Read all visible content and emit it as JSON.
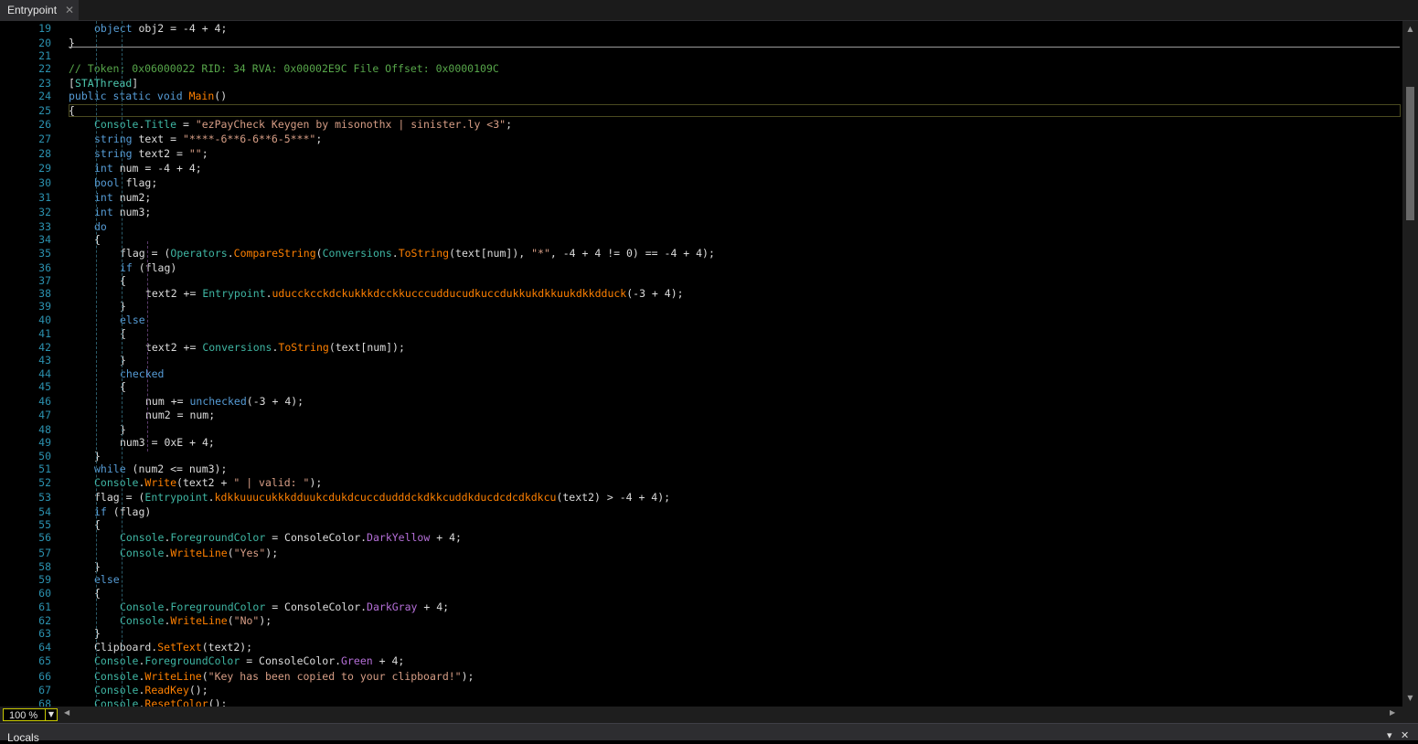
{
  "tab": {
    "label": "Entrypoint",
    "close": "✕"
  },
  "zoom": {
    "value": "100 %"
  },
  "bottom_panel": {
    "title": "Locals"
  },
  "lines": [
    {
      "n": "19",
      "ind": 2,
      "t": [
        [
          "kw",
          "object"
        ],
        [
          "pl",
          " obj2 = -4 + 4;"
        ]
      ]
    },
    {
      "n": "20",
      "ind": 1,
      "t": [
        [
          "pl",
          "}"
        ]
      ]
    },
    {
      "n": "21",
      "ind": 0,
      "t": []
    },
    {
      "n": "22",
      "ind": 1,
      "t": [
        [
          "cm",
          "// Token: 0x06000022 RID: 34 RVA: 0x00002E9C File Offset: 0x0000109C"
        ]
      ]
    },
    {
      "n": "23",
      "ind": 1,
      "t": [
        [
          "pl",
          "["
        ],
        [
          "cl",
          "STAThread"
        ],
        [
          "pl",
          "]"
        ]
      ]
    },
    {
      "n": "24",
      "ind": 1,
      "t": [
        [
          "kw",
          "public static void "
        ],
        [
          "me",
          "Main"
        ],
        [
          "pl",
          "()"
        ]
      ]
    },
    {
      "n": "25",
      "ind": 1,
      "t": [
        [
          "pl",
          "{"
        ]
      ]
    },
    {
      "n": "26",
      "ind": 2,
      "t": [
        [
          "pr",
          "Console"
        ],
        [
          "pl",
          "."
        ],
        [
          "pr",
          "Title"
        ],
        [
          "pl",
          " = "
        ],
        [
          "st",
          "\"ezPayCheck Keygen by misonothx | sinister.ly <3\""
        ],
        [
          "pl",
          ";"
        ]
      ]
    },
    {
      "n": "27",
      "ind": 2,
      "t": [
        [
          "kw",
          "string"
        ],
        [
          "pl",
          " text = "
        ],
        [
          "st",
          "\"****-6**6-6**6-5***\""
        ],
        [
          "pl",
          ";"
        ]
      ]
    },
    {
      "n": "28",
      "ind": 2,
      "t": [
        [
          "kw",
          "string"
        ],
        [
          "pl",
          " text2 = "
        ],
        [
          "st",
          "\"\""
        ],
        [
          "pl",
          ";"
        ]
      ]
    },
    {
      "n": "29",
      "ind": 2,
      "t": [
        [
          "kw",
          "int"
        ],
        [
          "pl",
          " num = -4 + 4;"
        ]
      ]
    },
    {
      "n": "30",
      "ind": 2,
      "t": [
        [
          "kw",
          "bool"
        ],
        [
          "pl",
          " flag;"
        ]
      ]
    },
    {
      "n": "31",
      "ind": 2,
      "t": [
        [
          "kw",
          "int"
        ],
        [
          "pl",
          " num2;"
        ]
      ]
    },
    {
      "n": "32",
      "ind": 2,
      "t": [
        [
          "kw",
          "int"
        ],
        [
          "pl",
          " num3;"
        ]
      ]
    },
    {
      "n": "33",
      "ind": 2,
      "t": [
        [
          "kw",
          "do"
        ]
      ]
    },
    {
      "n": "34",
      "ind": 2,
      "t": [
        [
          "pl",
          "{"
        ]
      ]
    },
    {
      "n": "35",
      "ind": 3,
      "t": [
        [
          "pl",
          "flag = ("
        ],
        [
          "pr",
          "Operators"
        ],
        [
          "pl",
          "."
        ],
        [
          "me",
          "CompareString"
        ],
        [
          "pl",
          "("
        ],
        [
          "pr",
          "Conversions"
        ],
        [
          "pl",
          "."
        ],
        [
          "me",
          "ToString"
        ],
        [
          "pl",
          "(text[num]), "
        ],
        [
          "st",
          "\"*\""
        ],
        [
          "pl",
          ", -4 + 4 != 0) == -4 + 4);"
        ]
      ]
    },
    {
      "n": "36",
      "ind": 3,
      "t": [
        [
          "kw",
          "if"
        ],
        [
          "pl",
          " (flag)"
        ]
      ]
    },
    {
      "n": "37",
      "ind": 3,
      "t": [
        [
          "pl",
          "{"
        ]
      ]
    },
    {
      "n": "38",
      "ind": 4,
      "t": [
        [
          "pl",
          "text2 += "
        ],
        [
          "pr",
          "Entrypoint"
        ],
        [
          "pl",
          "."
        ],
        [
          "me",
          "uducckcckdckukkkdcckkucccudducudkuccdukkukdkkuukdkkdduck"
        ],
        [
          "pl",
          "(-3 + 4);"
        ]
      ]
    },
    {
      "n": "39",
      "ind": 3,
      "t": [
        [
          "pl",
          "}"
        ]
      ]
    },
    {
      "n": "40",
      "ind": 3,
      "t": [
        [
          "kw",
          "else"
        ]
      ]
    },
    {
      "n": "41",
      "ind": 3,
      "t": [
        [
          "pl",
          "{"
        ]
      ]
    },
    {
      "n": "42",
      "ind": 4,
      "t": [
        [
          "pl",
          "text2 += "
        ],
        [
          "pr",
          "Conversions"
        ],
        [
          "pl",
          "."
        ],
        [
          "me",
          "ToString"
        ],
        [
          "pl",
          "(text[num]);"
        ]
      ]
    },
    {
      "n": "43",
      "ind": 3,
      "t": [
        [
          "pl",
          "}"
        ]
      ]
    },
    {
      "n": "44",
      "ind": 3,
      "t": [
        [
          "kw",
          "checked"
        ]
      ]
    },
    {
      "n": "45",
      "ind": 3,
      "t": [
        [
          "pl",
          "{"
        ]
      ]
    },
    {
      "n": "46",
      "ind": 4,
      "t": [
        [
          "pl",
          "num += "
        ],
        [
          "kw",
          "unchecked"
        ],
        [
          "pl",
          "(-3 + 4);"
        ]
      ]
    },
    {
      "n": "47",
      "ind": 4,
      "t": [
        [
          "pl",
          "num2 = num;"
        ]
      ]
    },
    {
      "n": "48",
      "ind": 3,
      "t": [
        [
          "pl",
          "}"
        ]
      ]
    },
    {
      "n": "49",
      "ind": 3,
      "t": [
        [
          "pl",
          "num3 = 0xE + 4;"
        ]
      ]
    },
    {
      "n": "50",
      "ind": 2,
      "t": [
        [
          "pl",
          "}"
        ]
      ]
    },
    {
      "n": "51",
      "ind": 2,
      "t": [
        [
          "kw",
          "while"
        ],
        [
          "pl",
          " (num2 <= num3);"
        ]
      ]
    },
    {
      "n": "52",
      "ind": 2,
      "t": [
        [
          "pr",
          "Console"
        ],
        [
          "pl",
          "."
        ],
        [
          "me",
          "Write"
        ],
        [
          "pl",
          "(text2 + "
        ],
        [
          "st",
          "\" | valid: \""
        ],
        [
          "pl",
          ");"
        ]
      ]
    },
    {
      "n": "53",
      "ind": 2,
      "t": [
        [
          "pl",
          "flag = ("
        ],
        [
          "pr",
          "Entrypoint"
        ],
        [
          "pl",
          "."
        ],
        [
          "me",
          "kdkkuuucukkkdduukcdukdcuccdudddckdkkcuddkducdcdcdkdkcu"
        ],
        [
          "pl",
          "(text2) > -4 + 4);"
        ]
      ]
    },
    {
      "n": "54",
      "ind": 2,
      "t": [
        [
          "kw",
          "if"
        ],
        [
          "pl",
          " (flag)"
        ]
      ]
    },
    {
      "n": "55",
      "ind": 2,
      "t": [
        [
          "pl",
          "{"
        ]
      ]
    },
    {
      "n": "56",
      "ind": 3,
      "t": [
        [
          "pr",
          "Console"
        ],
        [
          "pl",
          "."
        ],
        [
          "pr",
          "ForegroundColor"
        ],
        [
          "pl",
          " = ConsoleColor."
        ],
        [
          "en",
          "DarkYellow"
        ],
        [
          "pl",
          " + 4;"
        ]
      ]
    },
    {
      "n": "57",
      "ind": 3,
      "t": [
        [
          "pr",
          "Console"
        ],
        [
          "pl",
          "."
        ],
        [
          "me",
          "WriteLine"
        ],
        [
          "pl",
          "("
        ],
        [
          "st",
          "\"Yes\""
        ],
        [
          "pl",
          ");"
        ]
      ]
    },
    {
      "n": "58",
      "ind": 2,
      "t": [
        [
          "pl",
          "}"
        ]
      ]
    },
    {
      "n": "59",
      "ind": 2,
      "t": [
        [
          "kw",
          "else"
        ]
      ]
    },
    {
      "n": "60",
      "ind": 2,
      "t": [
        [
          "pl",
          "{"
        ]
      ]
    },
    {
      "n": "61",
      "ind": 3,
      "t": [
        [
          "pr",
          "Console"
        ],
        [
          "pl",
          "."
        ],
        [
          "pr",
          "ForegroundColor"
        ],
        [
          "pl",
          " = ConsoleColor."
        ],
        [
          "en",
          "DarkGray"
        ],
        [
          "pl",
          " + 4;"
        ]
      ]
    },
    {
      "n": "62",
      "ind": 3,
      "t": [
        [
          "pr",
          "Console"
        ],
        [
          "pl",
          "."
        ],
        [
          "me",
          "WriteLine"
        ],
        [
          "pl",
          "("
        ],
        [
          "st",
          "\"No\""
        ],
        [
          "pl",
          ");"
        ]
      ]
    },
    {
      "n": "63",
      "ind": 2,
      "t": [
        [
          "pl",
          "}"
        ]
      ]
    },
    {
      "n": "64",
      "ind": 2,
      "t": [
        [
          "pl",
          "Clipboard."
        ],
        [
          "me",
          "SetText"
        ],
        [
          "pl",
          "(text2);"
        ]
      ]
    },
    {
      "n": "65",
      "ind": 2,
      "t": [
        [
          "pr",
          "Console"
        ],
        [
          "pl",
          "."
        ],
        [
          "pr",
          "ForegroundColor"
        ],
        [
          "pl",
          " = ConsoleColor."
        ],
        [
          "en",
          "Green"
        ],
        [
          "pl",
          " + 4;"
        ]
      ]
    },
    {
      "n": "66",
      "ind": 2,
      "t": [
        [
          "pr",
          "Console"
        ],
        [
          "pl",
          "."
        ],
        [
          "me",
          "WriteLine"
        ],
        [
          "pl",
          "("
        ],
        [
          "st",
          "\"Key has been copied to your clipboard!\""
        ],
        [
          "pl",
          ");"
        ]
      ]
    },
    {
      "n": "67",
      "ind": 2,
      "t": [
        [
          "pr",
          "Console"
        ],
        [
          "pl",
          "."
        ],
        [
          "me",
          "ReadKey"
        ],
        [
          "pl",
          "();"
        ]
      ]
    },
    {
      "n": "68",
      "ind": 2,
      "t": [
        [
          "pr",
          "Console"
        ],
        [
          "pl",
          "."
        ],
        [
          "me",
          "ResetColor"
        ],
        [
          "pl",
          "();"
        ]
      ]
    }
  ],
  "colors": {
    "keyword": "#569cd6",
    "comment": "#57a64a",
    "string": "#d69d85",
    "method": "#ff8000",
    "enum": "#b56fd8",
    "line_number": "#2b91af"
  },
  "icons": {
    "tab_close": "close-icon",
    "zoom_dropdown": "chevron-down-icon",
    "scroll_up": "arrow-up-icon",
    "scroll_down": "arrow-down-icon",
    "scroll_left": "arrow-left-icon",
    "scroll_right": "arrow-right-icon"
  }
}
